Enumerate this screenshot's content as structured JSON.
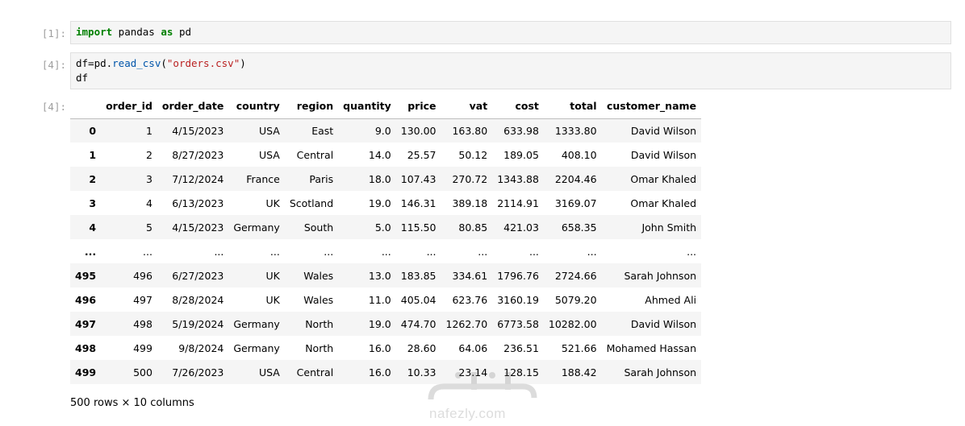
{
  "cells": [
    {
      "prompt": "[1]:",
      "code": {
        "kw1": "import",
        "mid": " pandas ",
        "kw2": "as",
        "tail": " pd"
      }
    },
    {
      "prompt": "[4]:",
      "code": {
        "line1_pre": "df=pd.",
        "line1_fn": "read_csv",
        "line1_open": "(",
        "line1_str": "\"orders.csv\"",
        "line1_close": ")",
        "line2": "df"
      }
    },
    {
      "prompt": "[4]:"
    }
  ],
  "table": {
    "columns": [
      "",
      "order_id",
      "order_date",
      "country",
      "region",
      "quantity",
      "price",
      "vat",
      "cost",
      "total",
      "customer_name"
    ],
    "rows": [
      [
        "0",
        "1",
        "4/15/2023",
        "USA",
        "East",
        "9.0",
        "130.00",
        "163.80",
        "633.98",
        "1333.80",
        "David Wilson"
      ],
      [
        "1",
        "2",
        "8/27/2023",
        "USA",
        "Central",
        "14.0",
        "25.57",
        "50.12",
        "189.05",
        "408.10",
        "David Wilson"
      ],
      [
        "2",
        "3",
        "7/12/2024",
        "France",
        "Paris",
        "18.0",
        "107.43",
        "270.72",
        "1343.88",
        "2204.46",
        "Omar Khaled"
      ],
      [
        "3",
        "4",
        "6/13/2023",
        "UK",
        "Scotland",
        "19.0",
        "146.31",
        "389.18",
        "2114.91",
        "3169.07",
        "Omar Khaled"
      ],
      [
        "4",
        "5",
        "4/15/2023",
        "Germany",
        "South",
        "5.0",
        "115.50",
        "80.85",
        "421.03",
        "658.35",
        "John Smith"
      ],
      [
        "...",
        "...",
        "...",
        "...",
        "...",
        "...",
        "...",
        "...",
        "...",
        "...",
        "..."
      ],
      [
        "495",
        "496",
        "6/27/2023",
        "UK",
        "Wales",
        "13.0",
        "183.85",
        "334.61",
        "1796.76",
        "2724.66",
        "Sarah Johnson"
      ],
      [
        "496",
        "497",
        "8/28/2024",
        "UK",
        "Wales",
        "11.0",
        "405.04",
        "623.76",
        "3160.19",
        "5079.20",
        "Ahmed Ali"
      ],
      [
        "497",
        "498",
        "5/19/2024",
        "Germany",
        "North",
        "19.0",
        "474.70",
        "1262.70",
        "6773.58",
        "10282.00",
        "David Wilson"
      ],
      [
        "498",
        "499",
        "9/8/2024",
        "Germany",
        "North",
        "16.0",
        "28.60",
        "64.06",
        "236.51",
        "521.66",
        "Mohamed Hassan"
      ],
      [
        "499",
        "500",
        "7/26/2023",
        "USA",
        "Central",
        "16.0",
        "10.33",
        "23.14",
        "128.15",
        "188.42",
        "Sarah Johnson"
      ]
    ],
    "footer": "500 rows × 10 columns"
  },
  "watermark": {
    "arabic": "نفذلي",
    "latin": "nafezly.com"
  }
}
